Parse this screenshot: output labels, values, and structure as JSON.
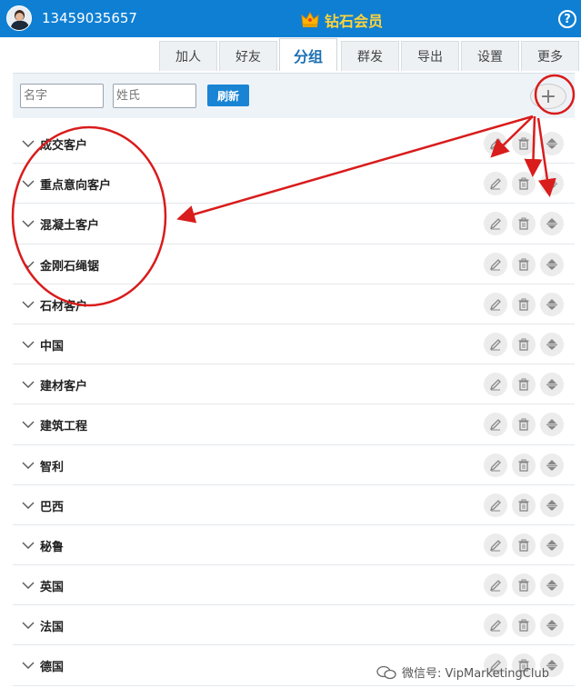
{
  "header": {
    "phone": "13459035657",
    "title": "钻石会员",
    "help": "?"
  },
  "tabs": [
    {
      "label": "加人",
      "active": false
    },
    {
      "label": "好友",
      "active": false
    },
    {
      "label": "分组",
      "active": true
    },
    {
      "label": "群发",
      "active": false
    },
    {
      "label": "导出",
      "active": false
    },
    {
      "label": "设置",
      "active": false
    },
    {
      "label": "更多",
      "active": false
    }
  ],
  "toolbar": {
    "first_name_placeholder": "名字",
    "last_name_placeholder": "姓氏",
    "refresh_label": "刷新",
    "add_label": "+"
  },
  "groups": [
    {
      "name": "成交客户"
    },
    {
      "name": "重点意向客户"
    },
    {
      "name": "混凝土客户"
    },
    {
      "name": "金刚石绳锯"
    },
    {
      "name": "石材客户"
    },
    {
      "name": "中国"
    },
    {
      "name": "建材客户"
    },
    {
      "name": "建筑工程"
    },
    {
      "name": "智利"
    },
    {
      "name": "巴西"
    },
    {
      "name": "秘鲁"
    },
    {
      "name": "英国"
    },
    {
      "name": "法国"
    },
    {
      "name": "德国"
    }
  ],
  "watermark": {
    "text": "微信号: VipMarketingClub"
  },
  "colors": {
    "header_bg": "#0f7fd3",
    "title": "#ffd43a",
    "annotation": "#d91c1c"
  },
  "icons": {
    "chevron": "chevron-down-icon",
    "edit": "pencil-icon",
    "delete": "trash-icon",
    "sort": "sort-icon"
  }
}
